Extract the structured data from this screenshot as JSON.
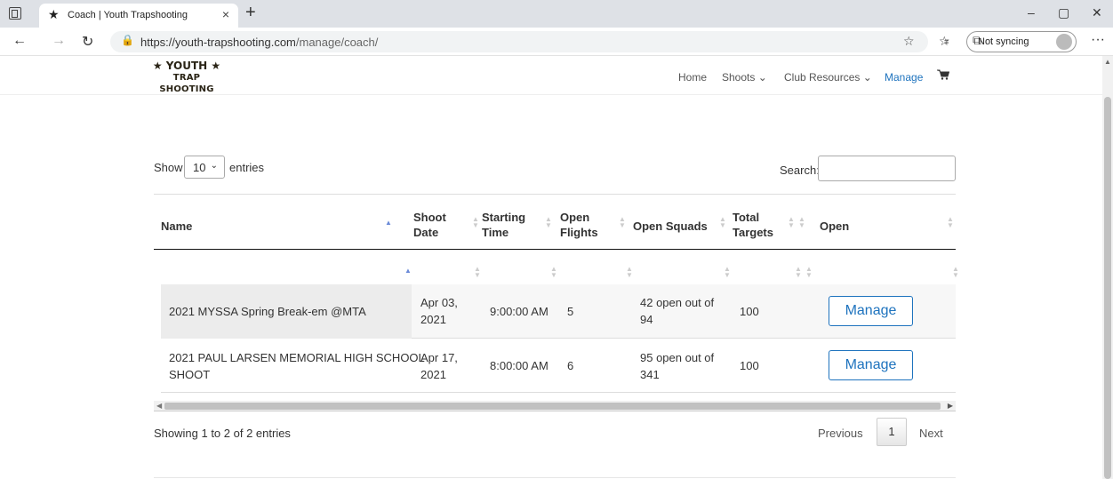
{
  "browser": {
    "tab_title": "Coach | Youth Trapshooting",
    "tab_favicon": "★",
    "url_host": "https://youth-trapshooting.com",
    "url_path": "/manage/coach/",
    "sync_label": "Not syncing"
  },
  "site": {
    "logo_line1": "★ YOUTH ★",
    "logo_line2": "TRAP SHOOTING",
    "nav": {
      "home": "Home",
      "shoots": "Shoots ⌄",
      "club_resources": "Club Resources ⌄",
      "manage": "Manage"
    },
    "colors": {
      "accent": "#1e73be",
      "text": "#333333"
    }
  },
  "table_controls": {
    "show_label": "Show",
    "length_value": "10",
    "entries_label": "entries",
    "search_label": "Search:"
  },
  "table": {
    "headers": {
      "name": "Name",
      "shoot_date_1": "Shoot",
      "shoot_date_2": "Date",
      "starting_time_1": "Starting",
      "starting_time_2": "Time",
      "open_flights_1": "Open",
      "open_flights_2": "Flights",
      "open_squads": "Open Squads",
      "total_targets_1": "Total",
      "total_targets_2": "Targets",
      "open": "Open"
    },
    "rows": [
      {
        "name_1": "2021 MYSSA Spring Break-em @MTA",
        "name_2": "",
        "date_1": "Apr 03,",
        "date_2": "2021",
        "time": "9:00:00 AM",
        "flights": "5",
        "squads_1": "42 open out of",
        "squads_2": "94",
        "targets": "100",
        "action": "Manage"
      },
      {
        "name_1": "2021 PAUL LARSEN MEMORIAL HIGH SCHOOL",
        "name_2": "SHOOT",
        "date_1": "Apr 17,",
        "date_2": "2021",
        "time": "8:00:00 AM",
        "flights": "6",
        "squads_1": "95 open out of",
        "squads_2": "341",
        "targets": "100",
        "action": "Manage"
      }
    ]
  },
  "pagination": {
    "info": "Showing 1 to 2 of 2 entries",
    "previous": "Previous",
    "current_page": "1",
    "next": "Next"
  }
}
